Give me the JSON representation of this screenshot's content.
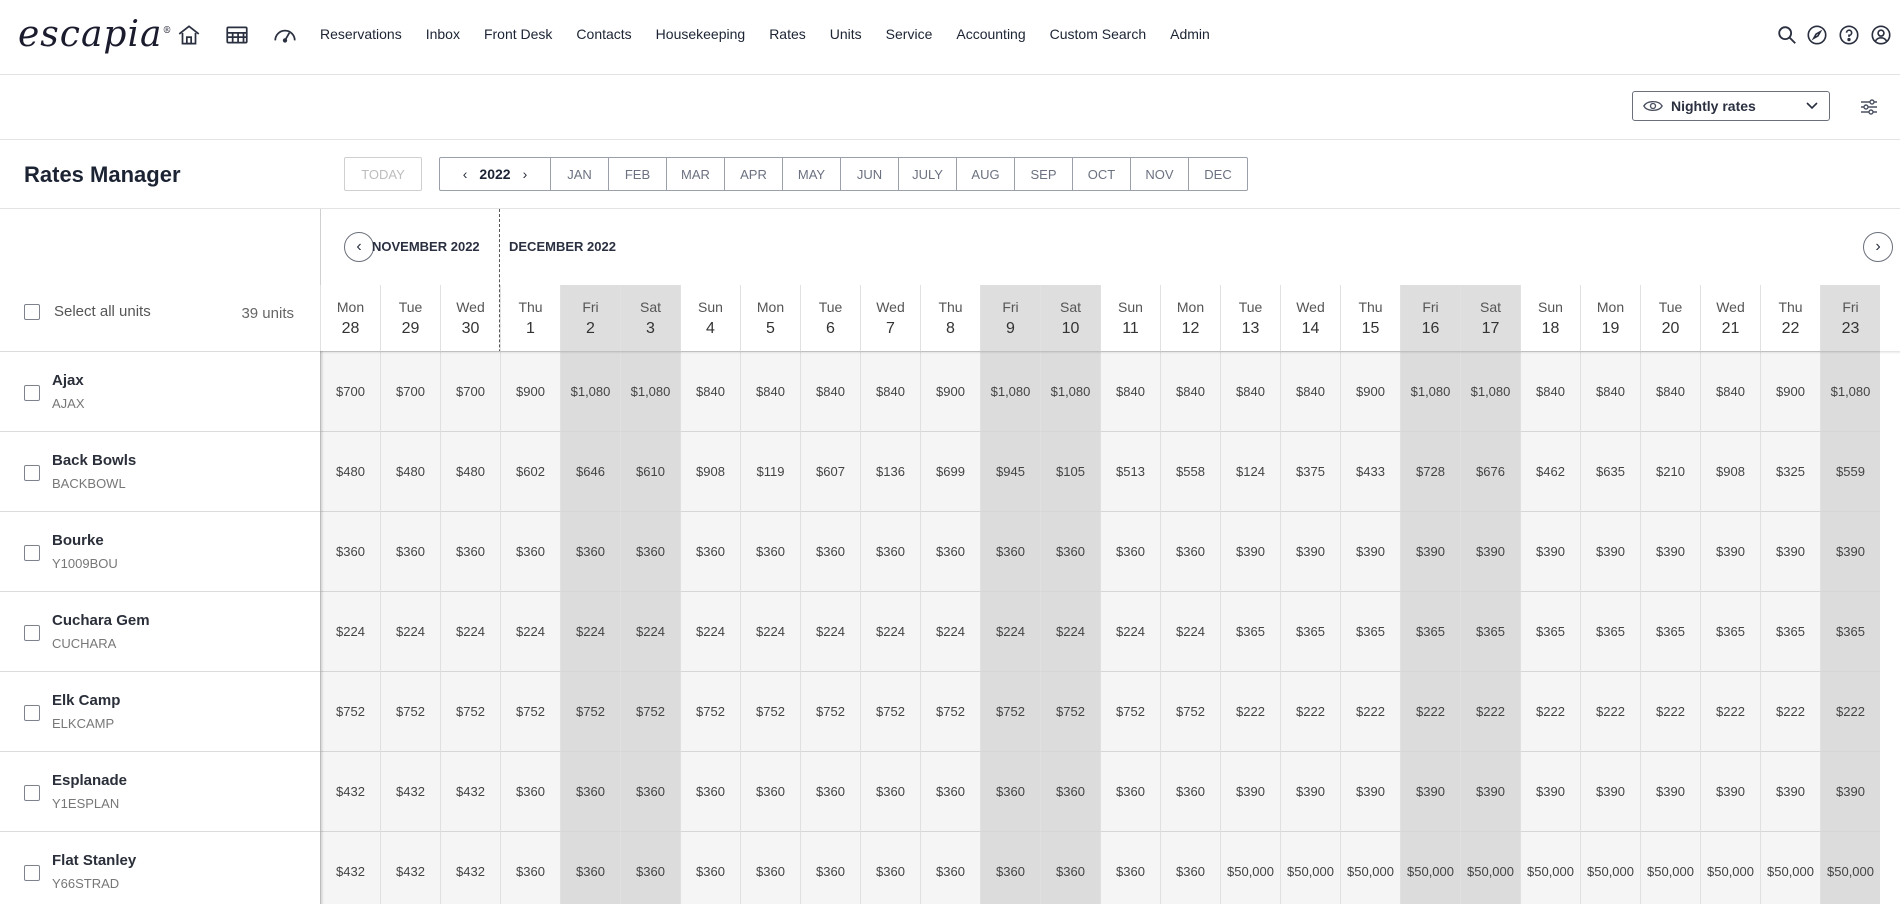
{
  "brand": {
    "logo": "escapia"
  },
  "nav": {
    "menu": [
      "Reservations",
      "Inbox",
      "Front Desk",
      "Contacts",
      "Housekeeping",
      "Rates",
      "Units",
      "Service",
      "Accounting",
      "Custom Search",
      "Admin"
    ]
  },
  "toolbar": {
    "view_select": "Nightly rates"
  },
  "page": {
    "title": "Rates Manager",
    "today_label": "TODAY",
    "year": "2022",
    "months": [
      "JAN",
      "FEB",
      "MAR",
      "APR",
      "MAY",
      "JUN",
      "JULY",
      "AUG",
      "SEP",
      "OCT",
      "NOV",
      "DEC"
    ]
  },
  "grid": {
    "select_all_label": "Select all units",
    "units_count": "39 units",
    "month_left": "NOVEMBER 2022",
    "month_right": "DECEMBER 2022",
    "days": [
      {
        "dow": "Mon",
        "dom": "28",
        "weekend": false
      },
      {
        "dow": "Tue",
        "dom": "29",
        "weekend": false
      },
      {
        "dow": "Wed",
        "dom": "30",
        "weekend": false
      },
      {
        "dow": "Thu",
        "dom": "1",
        "weekend": false
      },
      {
        "dow": "Fri",
        "dom": "2",
        "weekend": true
      },
      {
        "dow": "Sat",
        "dom": "3",
        "weekend": true
      },
      {
        "dow": "Sun",
        "dom": "4",
        "weekend": false
      },
      {
        "dow": "Mon",
        "dom": "5",
        "weekend": false
      },
      {
        "dow": "Tue",
        "dom": "6",
        "weekend": false
      },
      {
        "dow": "Wed",
        "dom": "7",
        "weekend": false
      },
      {
        "dow": "Thu",
        "dom": "8",
        "weekend": false
      },
      {
        "dow": "Fri",
        "dom": "9",
        "weekend": true
      },
      {
        "dow": "Sat",
        "dom": "10",
        "weekend": true
      },
      {
        "dow": "Sun",
        "dom": "11",
        "weekend": false
      },
      {
        "dow": "Mon",
        "dom": "12",
        "weekend": false
      },
      {
        "dow": "Tue",
        "dom": "13",
        "weekend": false
      },
      {
        "dow": "Wed",
        "dom": "14",
        "weekend": false
      },
      {
        "dow": "Thu",
        "dom": "15",
        "weekend": false
      },
      {
        "dow": "Fri",
        "dom": "16",
        "weekend": true
      },
      {
        "dow": "Sat",
        "dom": "17",
        "weekend": true
      },
      {
        "dow": "Sun",
        "dom": "18",
        "weekend": false
      },
      {
        "dow": "Mon",
        "dom": "19",
        "weekend": false
      },
      {
        "dow": "Tue",
        "dom": "20",
        "weekend": false
      },
      {
        "dow": "Wed",
        "dom": "21",
        "weekend": false
      },
      {
        "dow": "Thu",
        "dom": "22",
        "weekend": false
      },
      {
        "dow": "Fri",
        "dom": "23",
        "weekend": true
      }
    ],
    "units": [
      {
        "name": "Ajax",
        "code": "AJAX",
        "rates": [
          "$700",
          "$700",
          "$700",
          "$900",
          "$1,080",
          "$1,080",
          "$840",
          "$840",
          "$840",
          "$840",
          "$900",
          "$1,080",
          "$1,080",
          "$840",
          "$840",
          "$840",
          "$840",
          "$900",
          "$1,080",
          "$1,080",
          "$840",
          "$840",
          "$840",
          "$840",
          "$900",
          "$1,080"
        ]
      },
      {
        "name": "Back Bowls",
        "code": "BACKBOWL",
        "rates": [
          "$480",
          "$480",
          "$480",
          "$602",
          "$646",
          "$610",
          "$908",
          "$119",
          "$607",
          "$136",
          "$699",
          "$945",
          "$105",
          "$513",
          "$558",
          "$124",
          "$375",
          "$433",
          "$728",
          "$676",
          "$462",
          "$635",
          "$210",
          "$908",
          "$325",
          "$559"
        ]
      },
      {
        "name": "Bourke",
        "code": "Y1009BOU",
        "rates": [
          "$360",
          "$360",
          "$360",
          "$360",
          "$360",
          "$360",
          "$360",
          "$360",
          "$360",
          "$360",
          "$360",
          "$360",
          "$360",
          "$360",
          "$360",
          "$390",
          "$390",
          "$390",
          "$390",
          "$390",
          "$390",
          "$390",
          "$390",
          "$390",
          "$390",
          "$390"
        ]
      },
      {
        "name": "Cuchara Gem",
        "code": "CUCHARA",
        "rates": [
          "$224",
          "$224",
          "$224",
          "$224",
          "$224",
          "$224",
          "$224",
          "$224",
          "$224",
          "$224",
          "$224",
          "$224",
          "$224",
          "$224",
          "$224",
          "$365",
          "$365",
          "$365",
          "$365",
          "$365",
          "$365",
          "$365",
          "$365",
          "$365",
          "$365",
          "$365"
        ]
      },
      {
        "name": "Elk Camp",
        "code": "ELKCAMP",
        "rates": [
          "$752",
          "$752",
          "$752",
          "$752",
          "$752",
          "$752",
          "$752",
          "$752",
          "$752",
          "$752",
          "$752",
          "$752",
          "$752",
          "$752",
          "$752",
          "$222",
          "$222",
          "$222",
          "$222",
          "$222",
          "$222",
          "$222",
          "$222",
          "$222",
          "$222",
          "$222"
        ]
      },
      {
        "name": "Esplanade",
        "code": "Y1ESPLAN",
        "rates": [
          "$432",
          "$432",
          "$432",
          "$360",
          "$360",
          "$360",
          "$360",
          "$360",
          "$360",
          "$360",
          "$360",
          "$360",
          "$360",
          "$360",
          "$360",
          "$390",
          "$390",
          "$390",
          "$390",
          "$390",
          "$390",
          "$390",
          "$390",
          "$390",
          "$390",
          "$390"
        ]
      },
      {
        "name": "Flat Stanley",
        "code": "Y66STRAD",
        "rates": [
          "$432",
          "$432",
          "$432",
          "$360",
          "$360",
          "$360",
          "$360",
          "$360",
          "$360",
          "$360",
          "$360",
          "$360",
          "$360",
          "$360",
          "$360",
          "$50,000",
          "$50,000",
          "$50,000",
          "$50,000",
          "$50,000",
          "$50,000",
          "$50,000",
          "$50,000",
          "$50,000",
          "$50,000",
          "$50,000"
        ]
      }
    ]
  }
}
